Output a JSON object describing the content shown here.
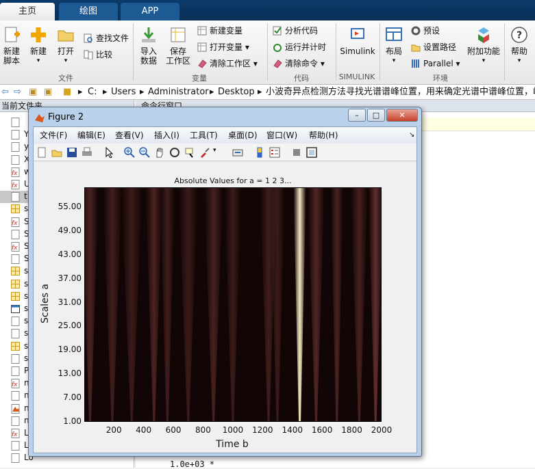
{
  "tabs": [
    {
      "label": "主页",
      "active": true
    },
    {
      "label": "绘图",
      "active": false
    },
    {
      "label": "APP",
      "active": false
    }
  ],
  "ribbon": {
    "new_script": "新建\n脚本",
    "new": "新建",
    "open": "打开",
    "find_files": "查找文件",
    "compare": "比较",
    "import_data": "导入\n数据",
    "save_workspace": "保存\n工作区",
    "new_variable": "新建变量",
    "open_variable": "打开变量",
    "clear_workspace": "清除工作区",
    "analyze_code": "分析代码",
    "run_and_time": "运行并计时",
    "clear_commands": "清除命令",
    "simulink": "Simulink",
    "layout": "布局",
    "preferences": "预设",
    "set_path": "设置路径",
    "parallel": "Parallel",
    "addons": "附加功能",
    "help": "帮助",
    "sections": {
      "file": "文件",
      "variable": "变量",
      "code": "代码",
      "simulink": "SIMULINK",
      "environment": "环境"
    }
  },
  "address": {
    "segments": [
      "C:",
      "Users",
      "Administrator",
      "Desktop",
      "小波奇异点检测方法寻找光谱谱峰位置，用来确定光谱中谱峰位置，峰高，"
    ]
  },
  "current_folder": {
    "title": "当前文件夹",
    "files": [
      "",
      "Y",
      "y",
      "X",
      "w",
      "U",
      "t",
      "s",
      "S",
      "S",
      "S",
      "S",
      "s",
      "s",
      "s",
      "s",
      "s",
      "s",
      "s",
      "s",
      "P",
      "n",
      "n",
      "n",
      "n",
      "L",
      "Lmax.asv",
      "Lo"
    ]
  },
  "command_window": {
    "title": "命令行窗口",
    "output": "1.0e+03 *"
  },
  "figure": {
    "title": "Figure 2",
    "menu": [
      "文件(F)",
      "编辑(E)",
      "查看(V)",
      "插入(I)",
      "工具(T)",
      "桌面(D)",
      "窗口(W)",
      "帮助(H)"
    ],
    "plot_title": "Absolute Values for a =  1 2 3...",
    "xlabel": "Time b",
    "ylabel": "Scales a"
  },
  "chart_data": {
    "type": "heatmap",
    "title": "Absolute Values for a =  1 2 3...",
    "xlabel": "Time b",
    "ylabel": "Scales a",
    "xlim": [
      1,
      2000
    ],
    "ylim": [
      1,
      60
    ],
    "xticks": [
      200,
      400,
      600,
      800,
      1000,
      1200,
      1400,
      1600,
      1800,
      2000
    ],
    "yticks": [
      "1.00",
      "7.00",
      "13.00",
      "19.00",
      "25.00",
      "31.00",
      "37.00",
      "43.00",
      "49.00",
      "55.00"
    ],
    "colormap": "pink",
    "colors": {
      "low": "#120505",
      "mid": "#7a3c3a",
      "high": "#f4e6c0"
    },
    "peak_columns": [
      {
        "b": 40,
        "strength": 0.55,
        "width": 40
      },
      {
        "b": 190,
        "strength": 0.45,
        "width": 45
      },
      {
        "b": 320,
        "strength": 0.4,
        "width": 50
      },
      {
        "b": 470,
        "strength": 0.55,
        "width": 40
      },
      {
        "b": 560,
        "strength": 0.45,
        "width": 35
      },
      {
        "b": 700,
        "strength": 0.4,
        "width": 45
      },
      {
        "b": 870,
        "strength": 0.5,
        "width": 45
      },
      {
        "b": 1000,
        "strength": 0.4,
        "width": 40
      },
      {
        "b": 1240,
        "strength": 0.45,
        "width": 40
      },
      {
        "b": 1300,
        "strength": 0.4,
        "width": 35
      },
      {
        "b": 1450,
        "strength": 1.0,
        "width": 30
      },
      {
        "b": 1560,
        "strength": 0.6,
        "width": 40
      },
      {
        "b": 1700,
        "strength": 0.55,
        "width": 30
      },
      {
        "b": 1850,
        "strength": 0.5,
        "width": 40
      },
      {
        "b": 1960,
        "strength": 0.75,
        "width": 35
      }
    ]
  }
}
